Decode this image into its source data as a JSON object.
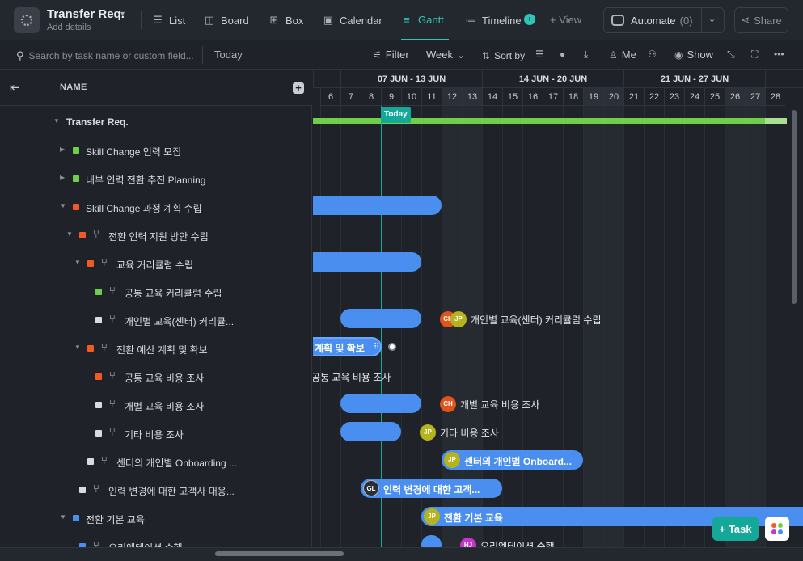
{
  "header": {
    "title": "Transfer Req.",
    "subtitle": "Add details",
    "views": [
      {
        "label": "List",
        "icon": "list-icon"
      },
      {
        "label": "Board",
        "icon": "board-icon"
      },
      {
        "label": "Box",
        "icon": "box-icon"
      },
      {
        "label": "Calendar",
        "icon": "calendar-icon"
      },
      {
        "label": "Gantt",
        "icon": "gantt-icon",
        "active": true
      },
      {
        "label": "Timeline",
        "icon": "timeline-icon"
      }
    ],
    "add_view": "+ View",
    "automate_label": "Automate",
    "automate_count": "(0)",
    "share_label": "Share"
  },
  "toolbar": {
    "search_placeholder": "Search by task name or custom field...",
    "today_label": "Today",
    "filter_label": "Filter",
    "week_label": "Week",
    "sort_label": "Sort by",
    "me_label": "Me",
    "show_label": "Show"
  },
  "list": {
    "name_header": "NAME",
    "rows": [
      {
        "label": "Transfer Req.",
        "color": "",
        "sub": false
      },
      {
        "label": "Skill Change 인력 모집",
        "color": "#6fcf48",
        "sub": false
      },
      {
        "label": "내부 인력 전환 추진 Planning",
        "color": "#6fcf48",
        "sub": false
      },
      {
        "label": "Skill Change 과정 계획 수립",
        "color": "#f15a22",
        "sub": false
      },
      {
        "label": "전환 인력 지원 방안 수립",
        "color": "#f15a22",
        "sub": true
      },
      {
        "label": "교육 커리큘럼 수립",
        "color": "#f15a22",
        "sub": true
      },
      {
        "label": "공통 교육 커리큘럼 수립",
        "color": "#6fcf48",
        "sub": true
      },
      {
        "label": "개인별 교육(센터) 커리큘...",
        "color": "#d8dbe0",
        "sub": true
      },
      {
        "label": "전환 예산 계획 및 확보",
        "color": "#f15a22",
        "sub": true
      },
      {
        "label": "공통 교육 비용 조사",
        "color": "#f15a22",
        "sub": true
      },
      {
        "label": "개별 교육 비용 조사",
        "color": "#d8dbe0",
        "sub": true
      },
      {
        "label": "기타 비용 조사",
        "color": "#d8dbe0",
        "sub": true
      },
      {
        "label": "센터의 개인별 Onboarding ...",
        "color": "#d8dbe0",
        "sub": true
      },
      {
        "label": "인력 변경에 대한 고객사 대응...",
        "color": "#d8dbe0",
        "sub": true
      },
      {
        "label": "전환 기본 교육",
        "color": "#4a8ff0",
        "sub": false
      },
      {
        "label": "오리엔테이션 수행",
        "color": "#4a8ff0",
        "sub": true
      }
    ]
  },
  "gantt": {
    "weeks": [
      "07 JUN - 13 JUN",
      "14 JUN - 20 JUN",
      "21 JUN - 27 JUN"
    ],
    "days": [
      "6",
      "7",
      "8",
      "9",
      "10",
      "11",
      "12",
      "13",
      "14",
      "15",
      "16",
      "17",
      "18",
      "19",
      "20",
      "21",
      "22",
      "23",
      "24",
      "25",
      "26",
      "27",
      "28"
    ],
    "today_label": "Today",
    "bar_labels": {
      "budget": "계획 및 확보",
      "common_cost": "공통 교육 비용 조사",
      "individual_curriculum": "개인별 교육(센터) 커리큘럼 수립",
      "individual_cost": "개별 교육 비용 조사",
      "other_cost": "기타 비용 조사",
      "onboarding": "센터의 개인별 Onboard...",
      "customer": "인력 변경에 대한 고객...",
      "basic_training": "전환 기본 교육",
      "orientation": "오리엔테이션 수행"
    },
    "avatars": {
      "ch": "CH",
      "jp": "JP",
      "gl": "GL",
      "hl": "HJ"
    }
  },
  "fab": {
    "task_label": "Task"
  }
}
